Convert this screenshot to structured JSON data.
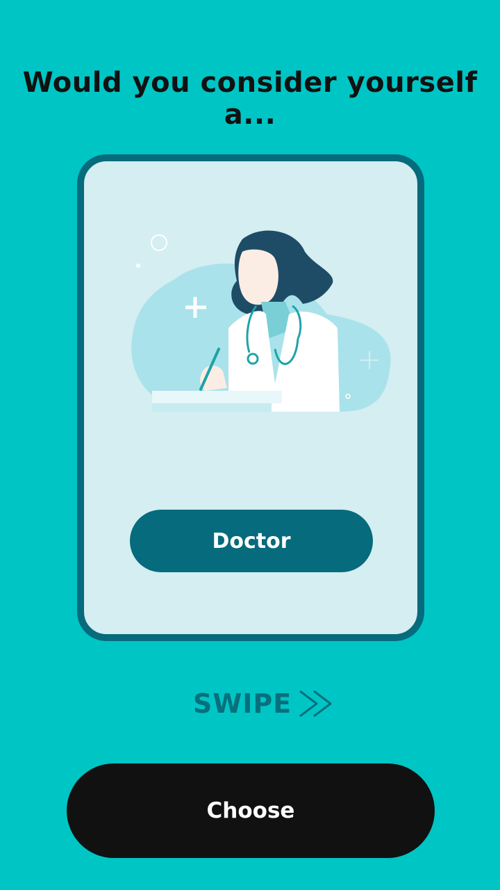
{
  "header": {
    "question": "Would you consider yourself a..."
  },
  "card": {
    "illustration": "doctor-illustration",
    "option_label": "Doctor"
  },
  "swipe": {
    "label": "SWIPE",
    "icon": "double-chevron-right-icon"
  },
  "footer": {
    "choose_label": "Choose"
  },
  "colors": {
    "background": "#00C5C5",
    "card_fill": "#D4EEF2",
    "card_border": "#066B7C",
    "option_button": "#066B7C",
    "swipe_text": "#07707C",
    "choose_button": "#111111"
  }
}
